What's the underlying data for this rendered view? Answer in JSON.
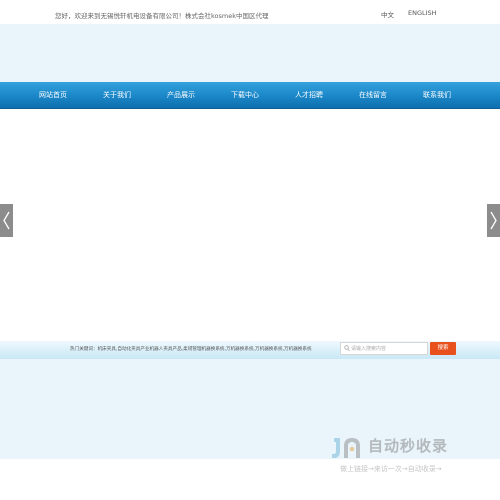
{
  "topbar": {
    "welcome": "您好，欢迎来到无锡悦轩机电设备有限公司！株式会社kosmek中国区代理",
    "lang_cn": "中文",
    "lang_en": "ENGLISH"
  },
  "nav": {
    "items": [
      {
        "label": "网站首页"
      },
      {
        "label": "关于我们"
      },
      {
        "label": "产品展示"
      },
      {
        "label": "下载中心"
      },
      {
        "label": "人才招聘"
      },
      {
        "label": "在线留言"
      },
      {
        "label": "联系我们"
      }
    ]
  },
  "banner": {
    "prev_icon": "chevron-left-icon",
    "next_icon": "chevron-right-icon"
  },
  "search": {
    "hot_keywords": "热门关键词：机床夹具,自动化夹具产业机器人夹具产品,柔韧管理机器换系统,万机器换系统,万机器换系统,万机器换系统",
    "placeholder": "请输入搜索内容",
    "button_label": "搜索"
  },
  "watermark": {
    "title": "自动秒收录",
    "subtitle": "做上链接→来访一次→自动收录→"
  },
  "colors": {
    "nav_top": "#35a2dd",
    "nav_bottom": "#0f6fae",
    "header_band": "#eaf5fb",
    "search_button": "#e8501c"
  }
}
